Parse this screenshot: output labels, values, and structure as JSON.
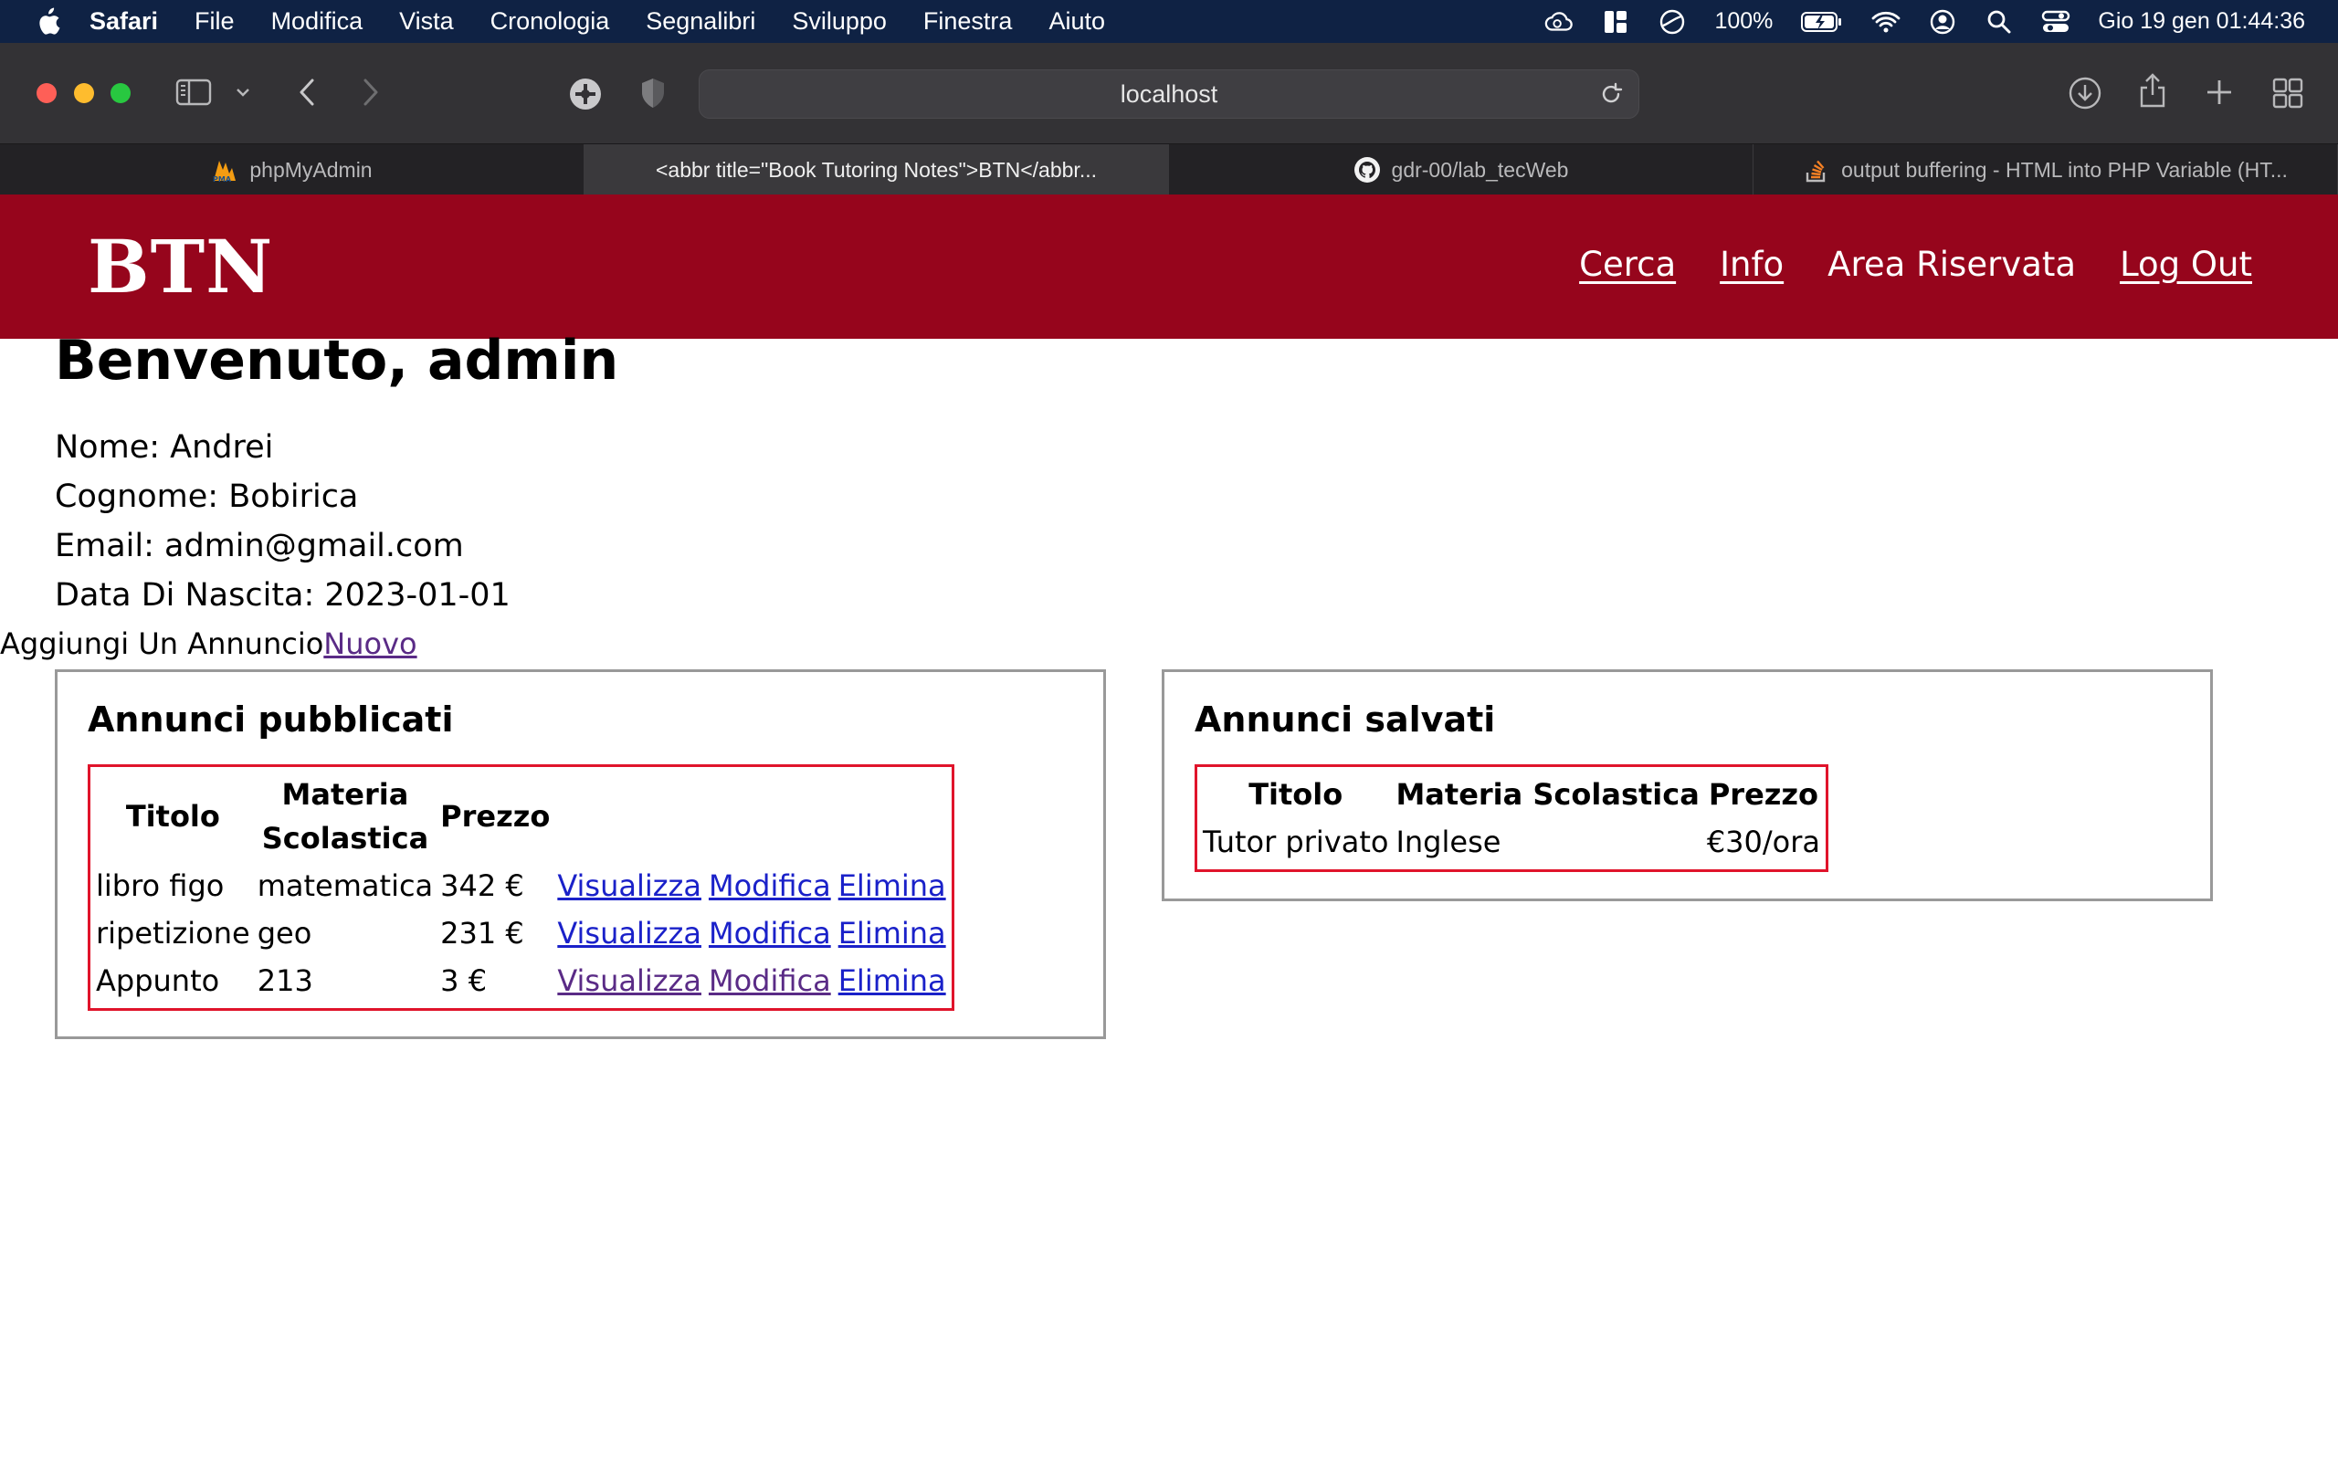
{
  "menubar": {
    "app_name": "Safari",
    "items": [
      "File",
      "Modifica",
      "Vista",
      "Cronologia",
      "Segnalibri",
      "Sviluppo",
      "Finestra",
      "Aiuto"
    ],
    "battery_percent": "100%",
    "datetime": "Gio 19 gen  01:44:36"
  },
  "browser": {
    "url": "localhost",
    "tabs": [
      {
        "title": "phpMyAdmin",
        "active": false,
        "icon": "phpmyadmin-icon"
      },
      {
        "title": "<abbr title=\"Book Tutoring Notes\">BTN</abbr...",
        "active": true,
        "icon": ""
      },
      {
        "title": "gdr-00/lab_tecWeb",
        "active": false,
        "icon": "github-icon"
      },
      {
        "title": "output buffering - HTML into PHP Variable (HT...",
        "active": false,
        "icon": "stackoverflow-icon"
      }
    ]
  },
  "site": {
    "logo": "BTN",
    "nav": [
      {
        "label": "Cerca",
        "underlined": true
      },
      {
        "label": "Info",
        "underlined": true
      },
      {
        "label": "Area Riservata",
        "underlined": false
      },
      {
        "label": "Log Out",
        "underlined": true
      }
    ],
    "brand_color": "#96051c"
  },
  "profile": {
    "welcome": "Benvenuto, admin",
    "rows": [
      "Nome: Andrei",
      "Cognome: Bobirica",
      "Email: admin@gmail.com",
      "Data Di Nascita: 2023-01-01"
    ],
    "add_label": "Aggiungi Un Annuncio",
    "add_link": "Nuovo"
  },
  "published": {
    "title": "Annunci pubblicati",
    "headers": [
      "Titolo",
      "Materia Scolastica",
      "Prezzo"
    ],
    "rows": [
      {
        "titolo": "libro figo",
        "materia": "matematica",
        "prezzo": "342 €",
        "view": "Visualizza",
        "edit": "Modifica",
        "delete": "Elimina"
      },
      {
        "titolo": "ripetizione",
        "materia": "geo",
        "prezzo": "231 €",
        "view": "Visualizza",
        "edit": "Modifica",
        "delete": "Elimina"
      },
      {
        "titolo": "Appunto",
        "materia": "213",
        "prezzo": "3 €",
        "view": "Visualizza",
        "edit": "Modifica",
        "delete": "Elimina"
      }
    ]
  },
  "saved": {
    "title": "Annunci salvati",
    "headers": [
      "Titolo",
      "Materia Scolastica",
      "Prezzo"
    ],
    "rows": [
      {
        "titolo": "Tutor privato",
        "materia": "Inglese",
        "prezzo": "€30/ora"
      }
    ]
  }
}
